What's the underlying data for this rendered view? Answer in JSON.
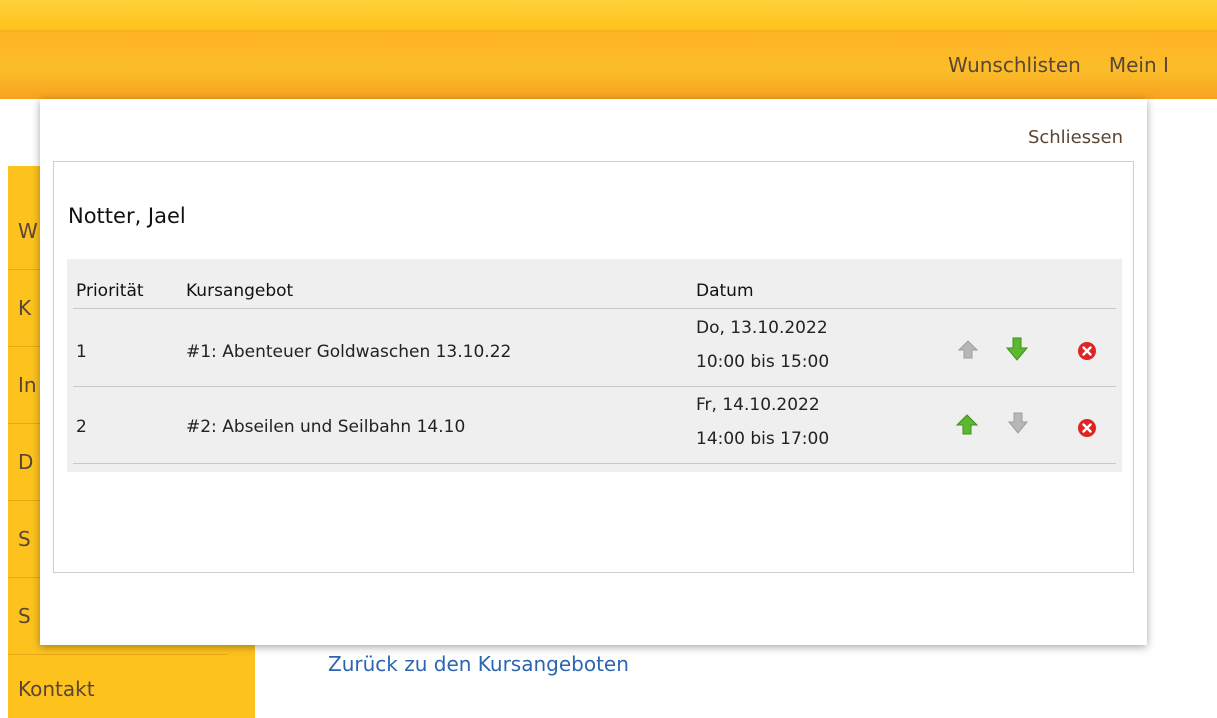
{
  "topnav": {
    "items": [
      "Wunschlisten",
      "Mein I"
    ]
  },
  "sidebar": {
    "items": [
      "W",
      "K",
      "In",
      "D",
      "S",
      "S",
      "Kontakt"
    ]
  },
  "page": {
    "back_link": "Zurück zu den Kursangeboten"
  },
  "modal": {
    "close_label": "Schliessen",
    "person_name": "Notter, Jael",
    "table": {
      "headers": [
        "Priorität",
        "Kursangebot",
        "Datum"
      ],
      "rows": [
        {
          "priority": "1",
          "course": "#1: Abenteuer Goldwaschen 13.10.22",
          "date_line1": "Do, 13.10.2022",
          "date_line2": "10:00 bis 15:00",
          "up_enabled": false,
          "down_enabled": true
        },
        {
          "priority": "2",
          "course": "#2: Abseilen und Seilbahn 14.10",
          "date_line1": "Fr, 14.10.2022",
          "date_line2": "14:00 bis 17:00",
          "up_enabled": true,
          "down_enabled": false
        }
      ]
    }
  },
  "icons": {
    "up": "arrow-up-icon",
    "down": "arrow-down-icon",
    "remove": "remove-icon"
  },
  "colors": {
    "header_orange": "#fbbd2a",
    "sidebar_yellow": "#fdc21e",
    "link_blue": "#2c66b1",
    "arrow_green": "#5cb82e",
    "arrow_gray": "#b7b7b7",
    "remove_red": "#e02424"
  }
}
